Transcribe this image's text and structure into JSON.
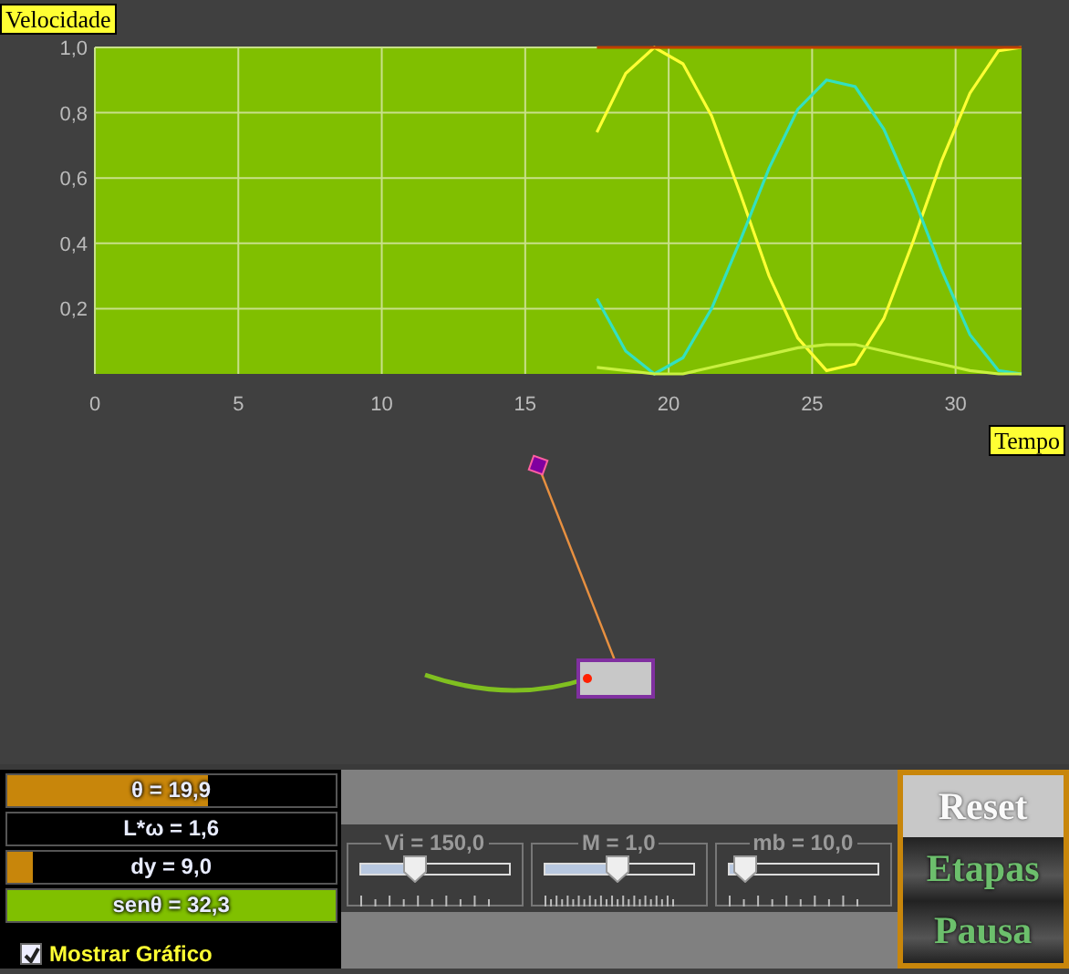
{
  "chart": {
    "y_label": "Velocidade",
    "x_label": "Tempo",
    "chart_data": {
      "type": "line",
      "x": [
        17.5,
        18.5,
        19.5,
        20.5,
        21.5,
        22.5,
        23.5,
        24.5,
        25.5,
        26.5,
        27.5,
        28.5,
        29.5,
        30.5,
        31.5,
        32.3
      ],
      "series": [
        {
          "color": "#ffff33",
          "values": [
            0.74,
            0.92,
            1.0,
            0.95,
            0.79,
            0.55,
            0.3,
            0.11,
            0.01,
            0.03,
            0.17,
            0.4,
            0.65,
            0.86,
            0.99,
            1.0
          ]
        },
        {
          "color": "#33e0c0",
          "values": [
            0.23,
            0.07,
            0.0,
            0.05,
            0.2,
            0.41,
            0.63,
            0.81,
            0.9,
            0.88,
            0.75,
            0.55,
            0.32,
            0.12,
            0.01,
            0.0
          ]
        },
        {
          "color": "#c8f040",
          "values": [
            0.02,
            0.01,
            0.0,
            0.0,
            0.02,
            0.04,
            0.06,
            0.08,
            0.09,
            0.09,
            0.07,
            0.05,
            0.03,
            0.01,
            0.0,
            0.0
          ]
        },
        {
          "color": "#c04000",
          "values": [
            1.0,
            1.0,
            1.0,
            1.0,
            1.0,
            1.0,
            1.0,
            1.0,
            1.0,
            1.0,
            1.0,
            1.0,
            1.0,
            1.0,
            1.0,
            1.0
          ]
        }
      ],
      "xlim": [
        0,
        32.3
      ],
      "ylim": [
        0,
        1
      ],
      "grid": true,
      "xticks": [
        0,
        5,
        10,
        15,
        20,
        25,
        30
      ],
      "yticks": [
        {
          "value": 0.2,
          "label": "0,2"
        },
        {
          "value": 0.4,
          "label": "0,4"
        },
        {
          "value": 0.6,
          "label": "0,6"
        },
        {
          "value": 0.8,
          "label": "0,8"
        },
        {
          "value": 1.0,
          "label": "1,0"
        }
      ]
    }
  },
  "readouts": [
    {
      "label": "θ = 19,9",
      "level": 0.61,
      "color": "#c8860b"
    },
    {
      "label": "L*ω = 1,6"
    },
    {
      "label": "dy = 9,0",
      "level": 0.08,
      "color": "#c8860b"
    },
    {
      "label": "senθ = 32,3",
      "level": 1,
      "color": "#80c000"
    }
  ],
  "show_graph": {
    "label": "Mostrar Gráfico",
    "checked": true
  },
  "sliders": [
    {
      "label": "Vi = 150,0",
      "level": 0.37,
      "kind": "coarse"
    },
    {
      "label": "M = 1,0",
      "level": 0.49,
      "kind": "fine"
    },
    {
      "label": "mb = 10,0",
      "level": 0.11,
      "kind": "coarse"
    }
  ],
  "buttons": [
    {
      "label": "Reset",
      "disabled": true
    },
    {
      "label": "Etapas",
      "disabled": false
    },
    {
      "label": "Pausa",
      "disabled": false
    }
  ]
}
